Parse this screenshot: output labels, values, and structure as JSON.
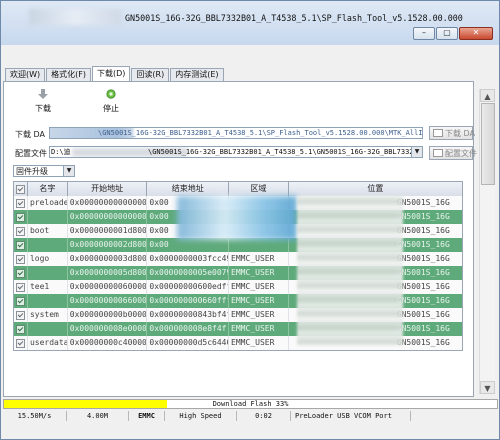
{
  "window": {
    "title": "GN5001S_16G-32G_BBL7332B01_A_T4538_5.1\\SP_Flash_Tool_v5.1528.00.000",
    "controls": {
      "minimize": "–",
      "maximize": "▢",
      "close": "✕"
    }
  },
  "tabs": [
    {
      "label": "欢迎(W)",
      "active": false
    },
    {
      "label": "格式化(F)",
      "active": false
    },
    {
      "label": "下载(D)",
      "active": true
    },
    {
      "label": "回读(R)",
      "active": false
    },
    {
      "label": "内存测试(E)",
      "active": false
    }
  ],
  "toolbar": {
    "download_label": "下载",
    "stop_label": "停止"
  },
  "download_agent": {
    "label": "下载 DA",
    "path": "\\GN5001S_16G-32G_BBL7332B01_A_T4538_5.1\\SP_Flash_Tool_v5.1528.00.000\\MTK_AllInOne_DA.bin",
    "button": "下载 DA"
  },
  "scatter": {
    "label": "配置文件",
    "path_prefix": "D:\\迪",
    "path": "\\GN5001S_16G-32G_BBL7332B01_A_T4538_5.1\\GN5001S_16G-32G_BBL7332B01_A_T45",
    "button": "配置文件"
  },
  "mode": {
    "selected": "固件升级"
  },
  "table": {
    "headers": [
      "名字",
      "开始地址",
      "结束地址",
      "区域",
      "位置"
    ],
    "rows": [
      {
        "name": "preloader",
        "start": "0x0000000000000000",
        "end": "0x00",
        "region": "",
        "location": "GN5001S_16G",
        "style": "white"
      },
      {
        "name": "",
        "start": "0x0000000000000000",
        "end": "0x00",
        "region": "",
        "location": "GN5001S_16G",
        "style": "green"
      },
      {
        "name": "boot",
        "start": "0x0000000001d80000",
        "end": "0x00",
        "region": "",
        "location": "GN5001S_16G",
        "style": "white"
      },
      {
        "name": "",
        "start": "0x0000000002d80000",
        "end": "0x00",
        "region": "",
        "location": "GN5001S_16G",
        "style": "green"
      },
      {
        "name": "logo",
        "start": "0x0000000003d80000",
        "end": "0x0000000003fcc49d",
        "region": "EMMC_USER",
        "location": "GN5001S_16G",
        "style": "white"
      },
      {
        "name": "",
        "start": "0x0000000005d80000",
        "end": "0x0000000005e0079f",
        "region": "EMMC_USER",
        "location": "GN5001S_16G",
        "style": "green"
      },
      {
        "name": "tee1",
        "start": "0x0000000006000000",
        "end": "0x00000000600edff",
        "region": "EMMC_USER",
        "location": "GN5001S_16G",
        "style": "white"
      },
      {
        "name": "",
        "start": "0x0000000006600000",
        "end": "0x000000000660fff",
        "region": "EMMC_USER",
        "location": "GN5001S_16G",
        "style": "green"
      },
      {
        "name": "system",
        "start": "0x000000000b000000",
        "end": "0x00000000843bf4f",
        "region": "EMMC_USER",
        "location": "GN5001S_16G",
        "style": "white"
      },
      {
        "name": "",
        "start": "0x000000008e000000",
        "end": "0x000000008e8f4f",
        "region": "EMMC_USER",
        "location": "GN5001S_16G",
        "style": "green"
      },
      {
        "name": "userdata",
        "start": "0x00000000c4000000",
        "end": "0x00000000d5c6446b",
        "region": "EMMC_USER",
        "location": "GN5001S_16G",
        "style": "white"
      }
    ]
  },
  "progress": {
    "label": "Download Flash 33%",
    "percent": 33,
    "color": "#ffff00"
  },
  "status": {
    "speed": "15.50M/s",
    "size": "4.00M",
    "storage": "EMMC",
    "usb_speed": "High Speed",
    "time": "0:02",
    "port": "PreLoader USB VCOM Port"
  },
  "colors": {
    "row_green": "#5faa7b",
    "progress_fill": "#ffff00",
    "titlebar": "#c7d8ee"
  }
}
